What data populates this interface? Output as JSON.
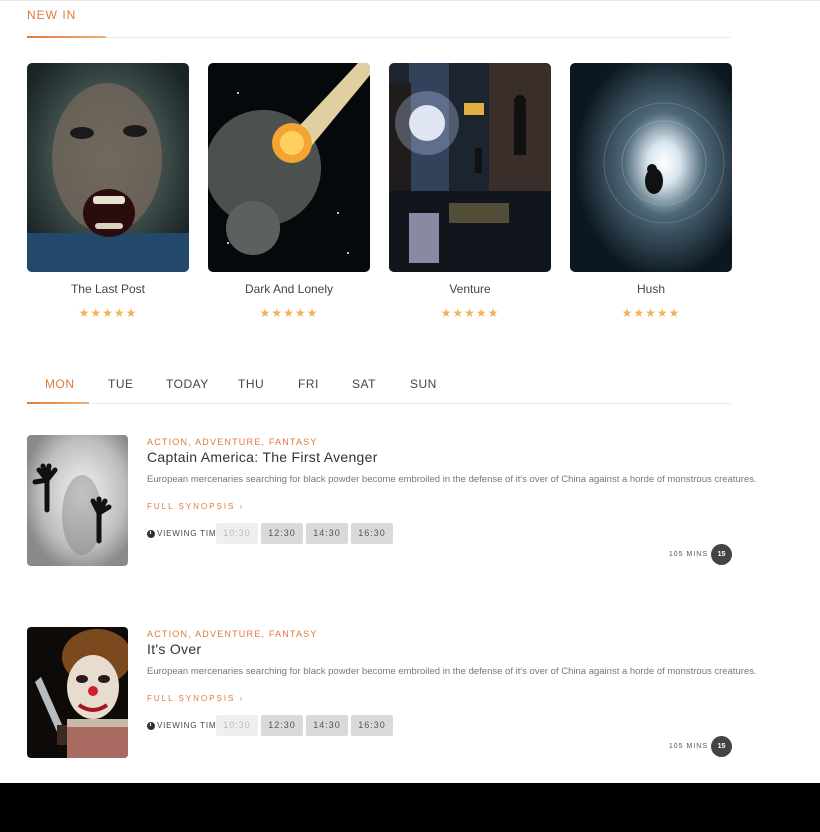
{
  "section": {
    "title": "NEW IN"
  },
  "movies": [
    {
      "title": "The Last Post",
      "stars": "★★★★★"
    },
    {
      "title": "Dark And Lonely",
      "stars": "★★★★★"
    },
    {
      "title": "Venture",
      "stars": "★★★★★"
    },
    {
      "title": "Hush",
      "stars": "★★★★★"
    }
  ],
  "days": [
    "MON",
    "TUE",
    "TODAY",
    "THU",
    "FRI",
    "SAT",
    "SUN"
  ],
  "active_day": "MON",
  "shows": [
    {
      "genres": "ACTION, ADVENTURE, FANTASY",
      "title": "Captain America: The First Avenger",
      "synopsis": "European mercenaries searching for black powder become embroiled in the defense of it's over of China against a horde of monstrous creatures.",
      "full_synopsis": "FULL SYNOPSIS ›",
      "viewing_label": "VIEWING TIMES",
      "times": [
        "10:30",
        "12:30",
        "14:30",
        "16:30"
      ],
      "duration": "105 MINS",
      "rating": "15"
    },
    {
      "genres": "ACTION, ADVENTURE, FANTASY",
      "title": "It's Over",
      "synopsis": "European mercenaries searching for black powder become embroiled in the defense of it's over of China against a horde of monstrous creatures.",
      "full_synopsis": "FULL SYNOPSIS ›",
      "viewing_label": "VIEWING TIMES",
      "times": [
        "10:30",
        "12:30",
        "14:30",
        "16:30"
      ],
      "duration": "105 MINS",
      "rating": "15"
    }
  ],
  "colors": {
    "accent": "#e07a3c",
    "star": "#f2b25a",
    "badge": "#444444"
  }
}
